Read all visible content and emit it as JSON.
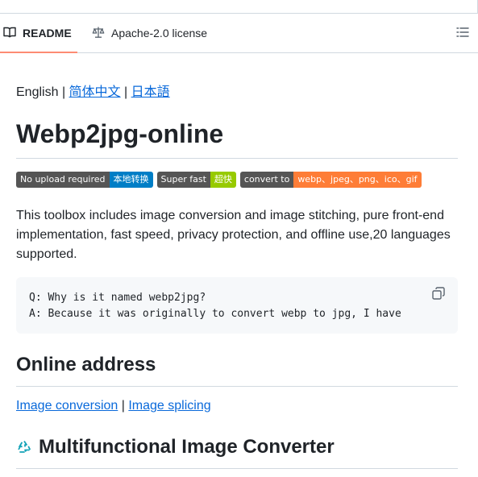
{
  "tabs": {
    "readme_label": "README",
    "license_label": "Apache-2.0 license"
  },
  "languages": {
    "current": "English",
    "separator": "|",
    "chinese": "简体中文",
    "japanese": "日本語"
  },
  "title": "Webp2jpg-online",
  "badges": [
    {
      "left": "No upload required",
      "right": "本地转换",
      "color": "#007ec6"
    },
    {
      "left": "Super fast",
      "right": "超快",
      "color": "#97ca00"
    },
    {
      "left": "convert to",
      "right": "webp、jpeg、png、ico、gif",
      "color": "#fe7d37"
    }
  ],
  "description": "This toolbox includes image conversion and image stitching, pure front-end implementation, fast speed, privacy protection, and offline use,20 languages supported.",
  "code": {
    "line1": "Q: Why is it named webp2jpg?",
    "line2": "A: Because it was originally to convert webp to jpg, I have"
  },
  "online_section": {
    "heading": "Online address",
    "link1": "Image conversion",
    "separator": "|",
    "link2": "Image splicing"
  },
  "converter_section": {
    "heading": "Multifunctional Image Converter"
  },
  "icons": [
    "book-icon",
    "scale-icon",
    "list-icon",
    "copy-icon",
    "recycle-icon"
  ]
}
